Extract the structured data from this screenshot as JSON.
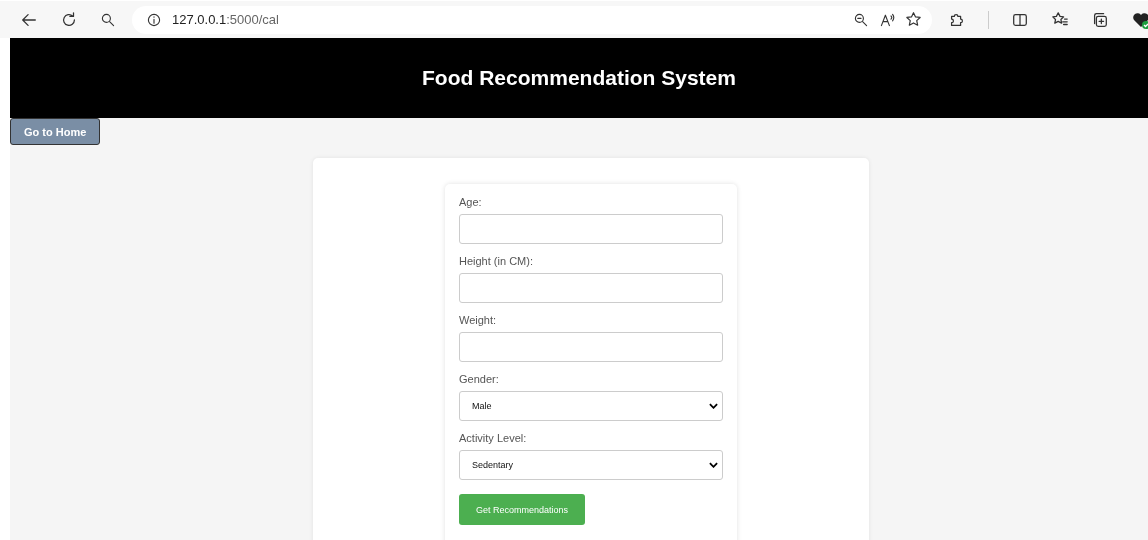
{
  "browser": {
    "url_host": "127.0.0.1",
    "url_path": ":5000/cal"
  },
  "header": {
    "title": "Food Recommendation System"
  },
  "home_button": "Go to Home",
  "form": {
    "fields": [
      {
        "kind": "text",
        "label": "Age:"
      },
      {
        "kind": "text",
        "label": "Height (in CM):"
      },
      {
        "kind": "text",
        "label": "Weight:"
      },
      {
        "kind": "select",
        "label": "Gender:",
        "value": "Male"
      },
      {
        "kind": "select",
        "label": "Activity Level:",
        "value": "Sedentary"
      }
    ],
    "submit": "Get Recommendations"
  }
}
